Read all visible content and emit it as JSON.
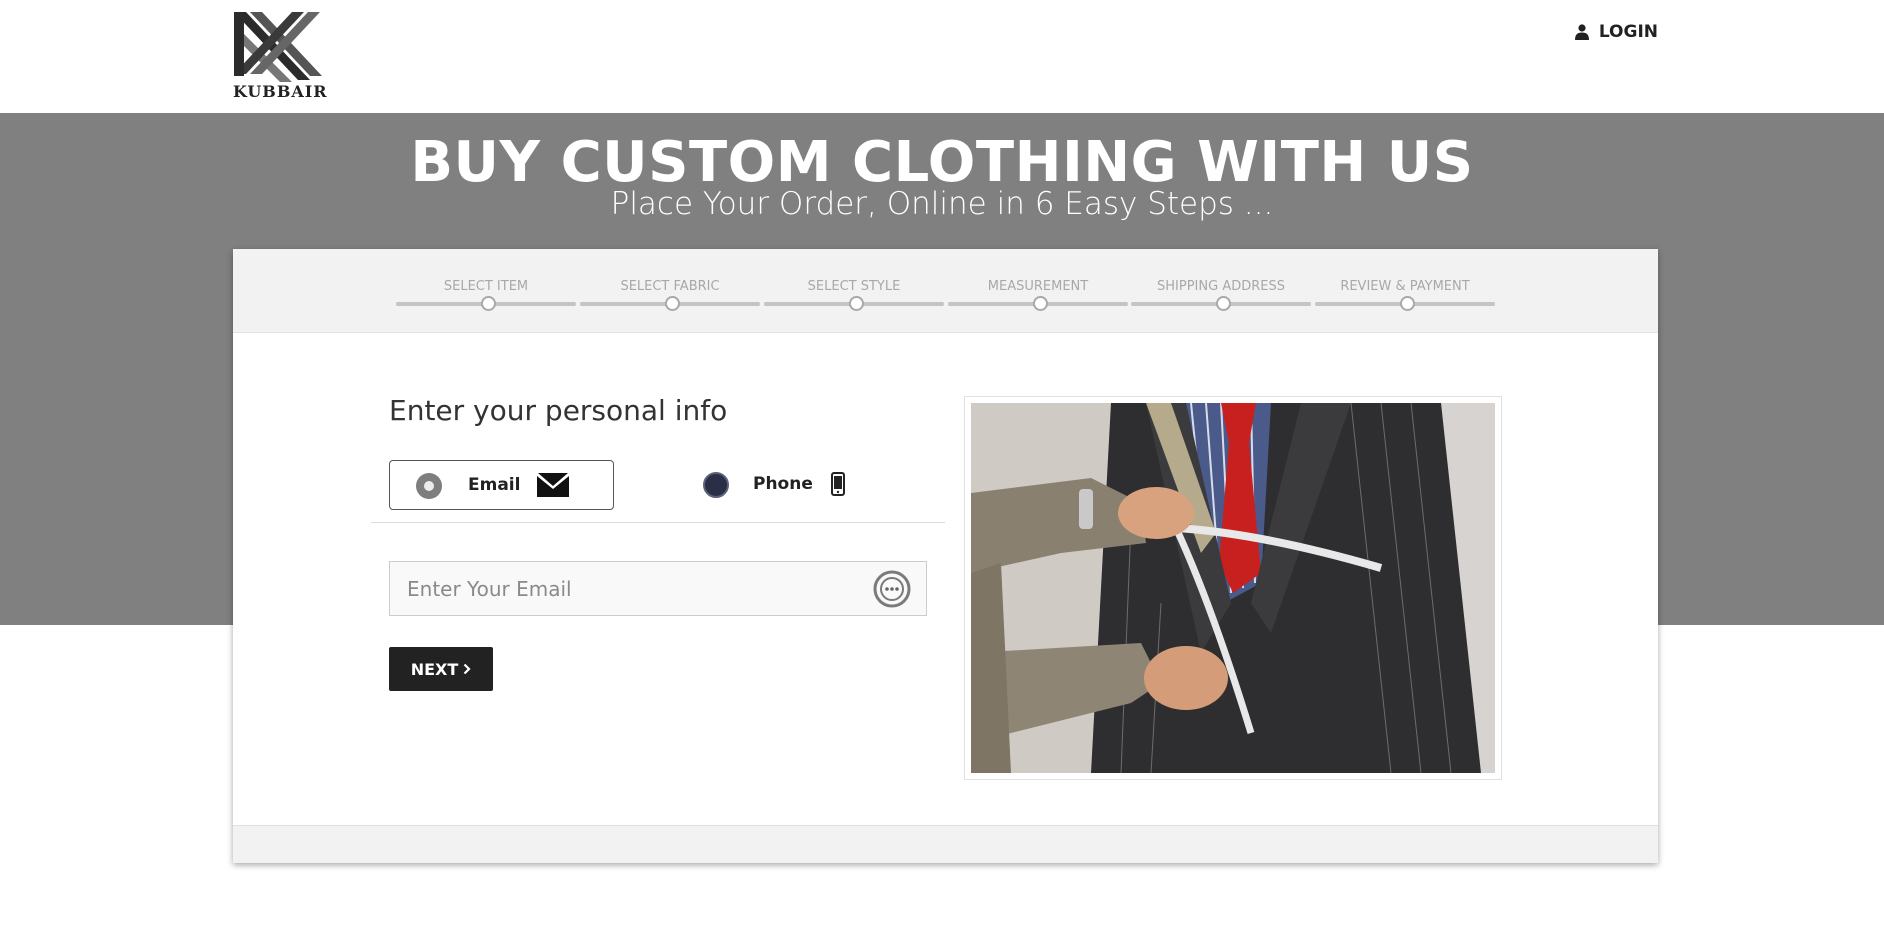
{
  "brand": {
    "name": "KUBBAIR"
  },
  "header": {
    "login_label": "LOGIN"
  },
  "hero": {
    "title": "BUY CUSTOM CLOTHING WITH US",
    "subtitle": "Place Your Order, Online in 6 Easy Steps ..."
  },
  "steps": [
    {
      "label": "SELECT ITEM"
    },
    {
      "label": "SELECT FABRIC"
    },
    {
      "label": "SELECT STYLE"
    },
    {
      "label": "MEASUREMENT"
    },
    {
      "label": "SHIPPING ADDRESS"
    },
    {
      "label": "REVIEW & PAYMENT"
    }
  ],
  "form": {
    "title": "Enter your personal info",
    "options": [
      {
        "label": "Email",
        "icon": "envelope-icon",
        "selected": true
      },
      {
        "label": "Phone",
        "icon": "mobile-phone-icon",
        "selected": false
      }
    ],
    "email_placeholder": "Enter Your Email",
    "next_label": "NEXT"
  },
  "colors": {
    "hero_bg": "#808080",
    "button_bg": "#222222",
    "steps_bg": "#f2f2f2"
  }
}
